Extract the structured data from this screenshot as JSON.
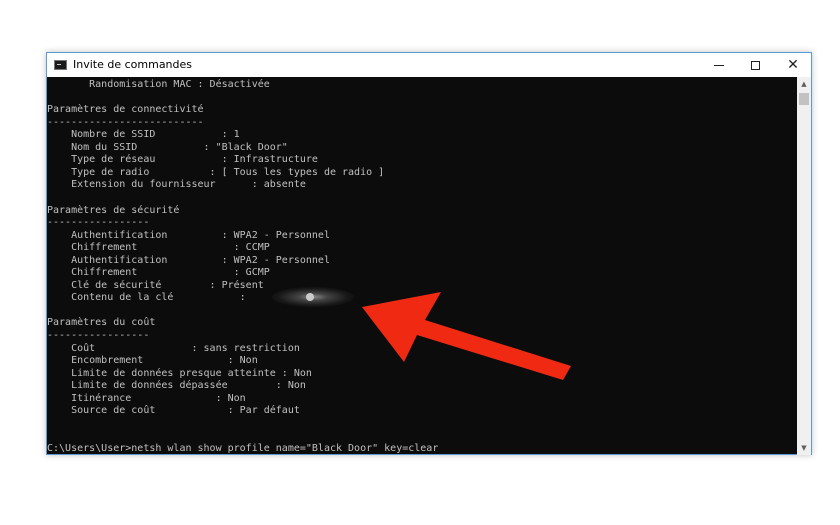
{
  "window": {
    "title": "Invite de commandes",
    "minimize_label": "—",
    "maximize_label": "☐",
    "close_label": "✕"
  },
  "console": {
    "lines": [
      "       Randomisation MAC : Désactivée",
      "",
      "Paramètres de connectivité",
      "--------------------------",
      "    Nombre de SSID           : 1",
      "    Nom du SSID           : \"Black Door\"",
      "    Type de réseau           : Infrastructure",
      "    Type de radio          : [ Tous les types de radio ]",
      "    Extension du fournisseur      : absente",
      "",
      "Paramètres de sécurité",
      "-----------------",
      "    Authentification         : WPA2 - Personnel",
      "    Chiffrement                : CCMP",
      "    Authentification         : WPA2 - Personnel",
      "    Chiffrement                : GCMP",
      "    Clé de sécurité        : Présent",
      "    Contenu de la clé           :",
      "",
      "Paramètres du coût",
      "-----------------",
      "    Coût                : sans restriction",
      "    Encombrement              : Non",
      "    Limite de données presque atteinte : Non",
      "    Limite de données dépassée        : Non",
      "    Itinérance              : Non",
      "    Source de coût            : Par défaut",
      "",
      "",
      "C:\\Users\\User>netsh wlan show profile name=\"Black Door\" key=clear"
    ]
  },
  "scrollbar": {
    "up_glyph": "▲",
    "down_glyph": "▼"
  },
  "annotation": {
    "arrow_color": "#f02a12"
  }
}
